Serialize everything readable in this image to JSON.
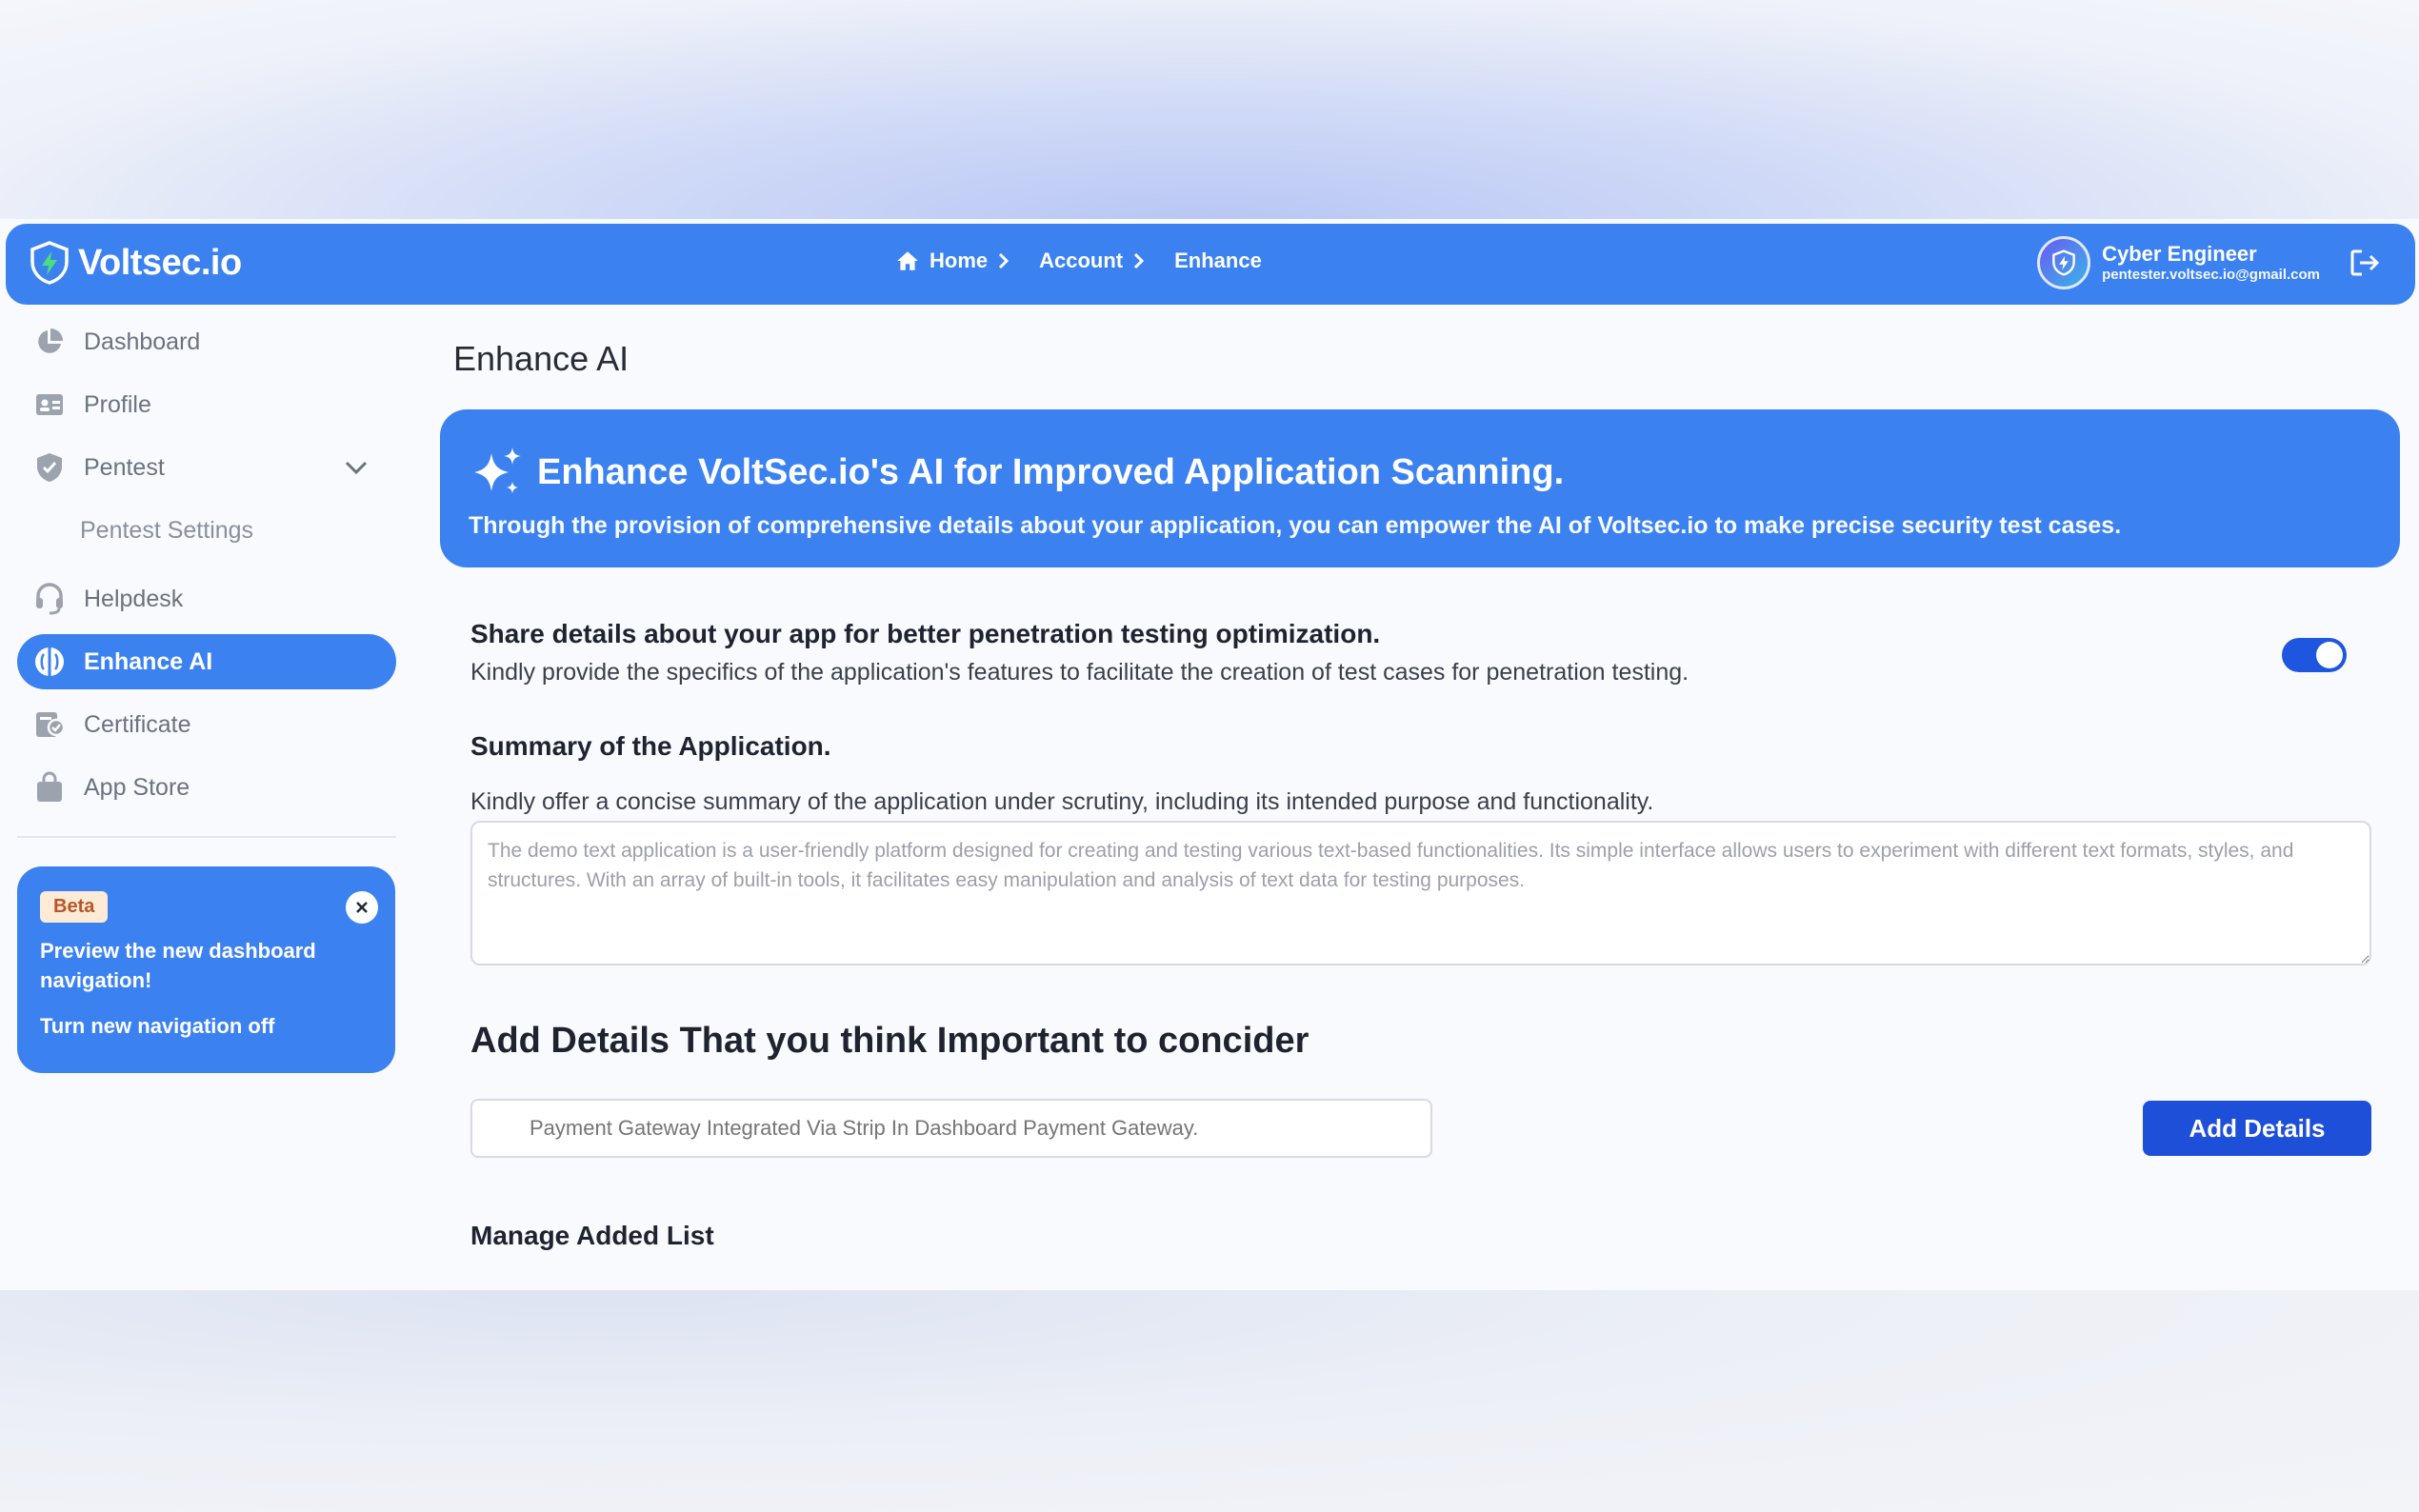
{
  "header": {
    "brand": "Voltsec.io",
    "breadcrumb": [
      "Home",
      "Account",
      "Enhance"
    ],
    "user_name": "Cyber Engineer",
    "user_email": "pentester.voltsec.io@gmail.com"
  },
  "sidebar": {
    "items": [
      {
        "label": "Dashboard",
        "icon": "pie-chart-icon"
      },
      {
        "label": "Profile",
        "icon": "id-card-icon"
      },
      {
        "label": "Pentest",
        "icon": "shield-check-icon"
      },
      {
        "label": "Pentest Settings"
      },
      {
        "label": "Helpdesk",
        "icon": "headset-icon"
      },
      {
        "label": "Enhance AI",
        "icon": "ai-brain-icon",
        "active": true
      },
      {
        "label": "Certificate",
        "icon": "certificate-icon"
      },
      {
        "label": "App Store",
        "icon": "shopping-bag-icon"
      }
    ],
    "beta": {
      "badge": "Beta",
      "text": "Preview the new dashboard navigation!",
      "link": "Turn new navigation off"
    }
  },
  "main": {
    "title": "Enhance AI",
    "hero_title": "Enhance VoltSec.io's AI for Improved Application Scanning.",
    "hero_subtitle": "Through the provision of comprehensive details about your application, you can empower the AI of Voltsec.io to make precise security test cases.",
    "share_heading": "Share details about your app for better penetration testing optimization.",
    "share_desc": "Kindly provide the specifics of the application's features to facilitate the creation of test cases for penetration testing.",
    "share_toggle_on": true,
    "summary_heading": "Summary of the Application.",
    "summary_desc": "Kindly offer a concise summary of the application under scrutiny, including its intended purpose and functionality.",
    "summary_value": "The demo text application is a user-friendly platform designed for creating and testing various text-based functionalities. Its simple interface allows users to experiment with different text formats, styles, and structures. With an array of built-in tools, it facilitates easy manipulation and analysis of text data for testing purposes.",
    "add_heading": "Add Details That you think Important to concider",
    "detail_placeholder": "Payment Gateway Integrated Via Strip In Dashboard Payment Gateway.",
    "add_button": "Add Details",
    "manage_heading": "Manage Added List"
  },
  "colors": {
    "accent": "#3b82f0",
    "button": "#1e4fd8"
  }
}
